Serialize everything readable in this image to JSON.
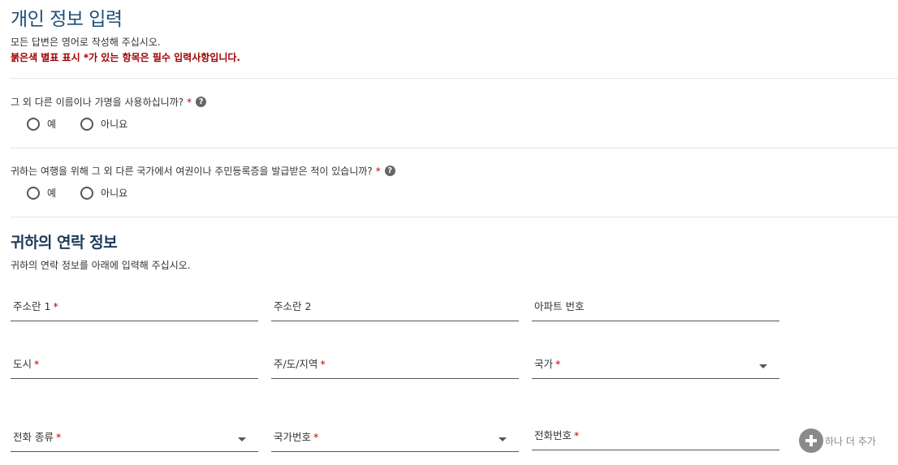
{
  "page": {
    "title": "개인 정보 입력",
    "intro": "모든 답변은 영어로 작성해 주십시오.",
    "required_note": "붉은색 별표 표시 *가 있는 항목은 필수 입력사항입니다."
  },
  "questions": [
    {
      "text": "그 외 다른 이름이나 가명을 사용하십니까?",
      "required_mark": "*",
      "help_icon": "question-circle",
      "options": [
        "예",
        "아니요"
      ]
    },
    {
      "text": "귀하는 여행을 위해 그 외 다른 국가에서 여권이나 주민등록증을 발급받은 적이 있습니까?",
      "required_mark": "*",
      "help_icon": "question-circle",
      "options": [
        "예",
        "아니요"
      ]
    }
  ],
  "contact": {
    "title": "귀하의 연락 정보",
    "description": "귀하의 연락 정보를 아래에 입력해 주십시오.",
    "fields": {
      "address1": {
        "label": "주소란 1",
        "required_mark": "*"
      },
      "address2": {
        "label": "주소란 2"
      },
      "apartment": {
        "label": "아파트 번호"
      },
      "city": {
        "label": "도시",
        "required_mark": "*"
      },
      "state": {
        "label": "주/도/지역",
        "required_mark": "*"
      },
      "country": {
        "label": "국가",
        "required_mark": "*"
      },
      "phone_type": {
        "label": "전화 종류",
        "required_mark": "*"
      },
      "country_code": {
        "label": "국가번호",
        "required_mark": "*"
      },
      "phone_number": {
        "label": "전화번호",
        "required_mark": "*"
      }
    },
    "add_more_label": "하나 더 추가"
  },
  "colors": {
    "title": "#1f4e79",
    "required": "#c00000",
    "required_note": "#a10000",
    "add_icon": "#8a8a8a"
  }
}
